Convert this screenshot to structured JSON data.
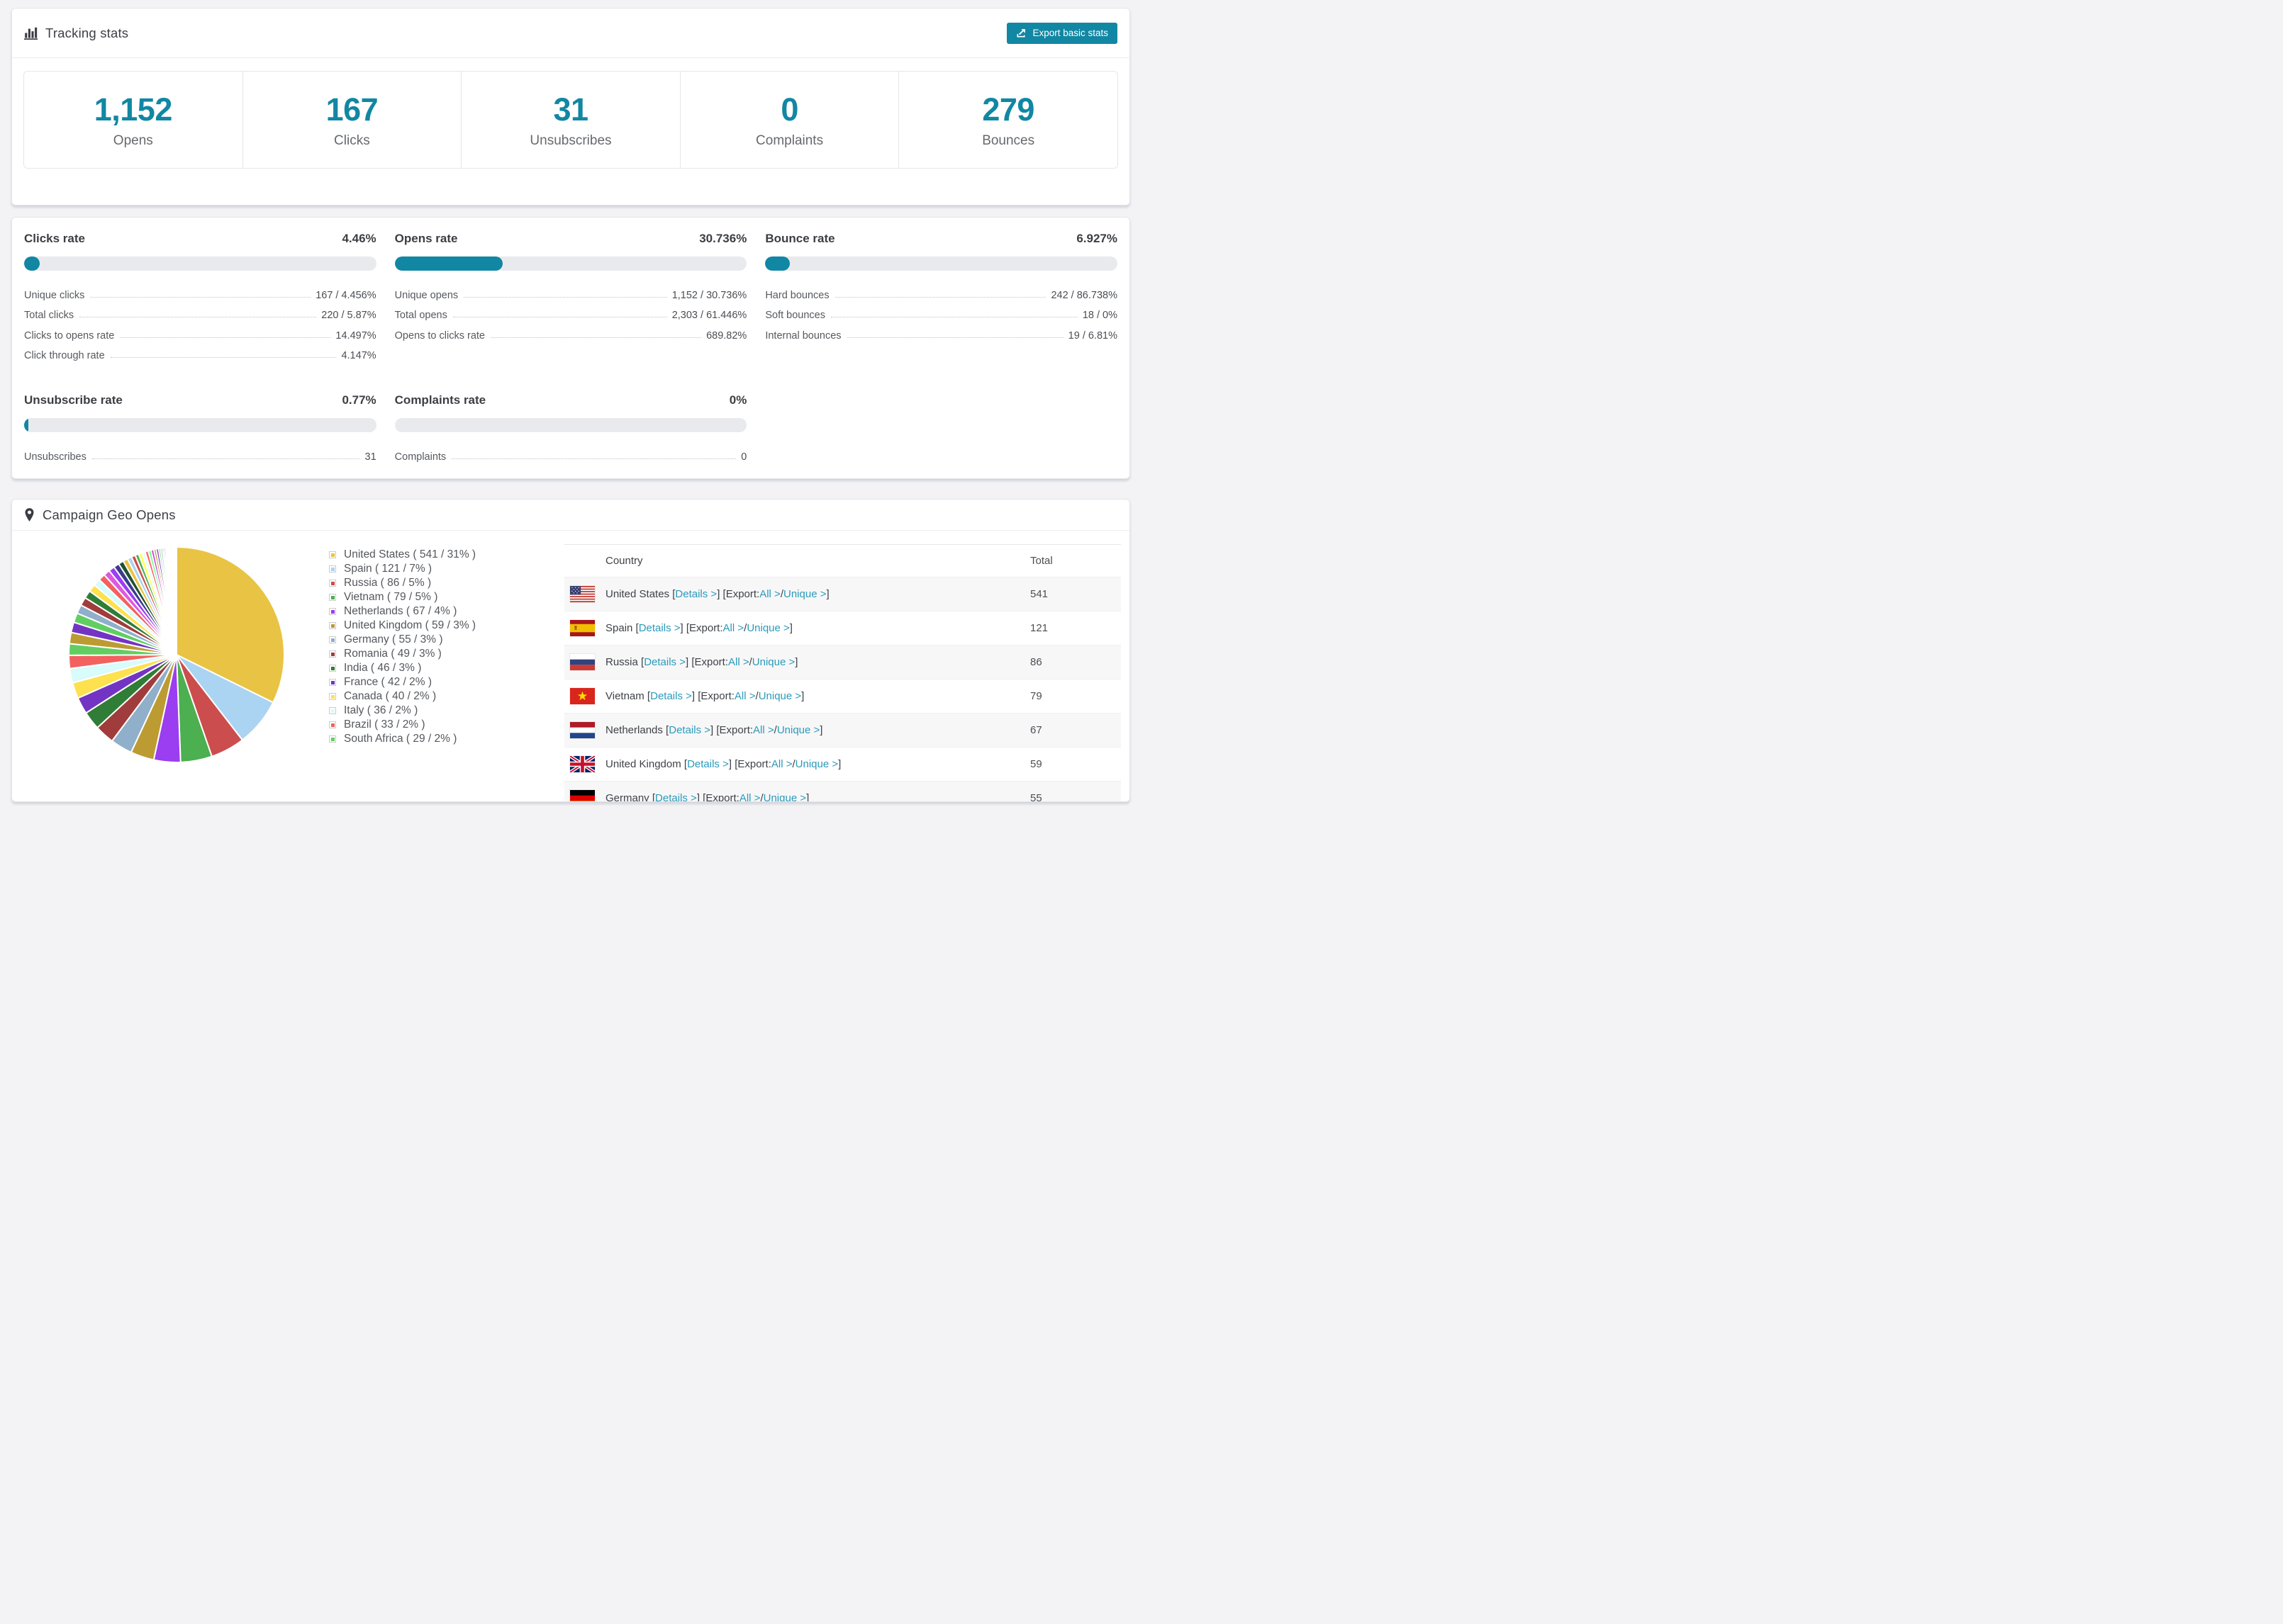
{
  "colors": {
    "accent": "#1187a3",
    "link": "#2b9aba",
    "bar_background": "#e9eaee",
    "alt_row_background": "#f7f7f8"
  },
  "tracking": {
    "title": "Tracking stats",
    "export_label": "Export basic stats",
    "stats": [
      {
        "value": "1,152",
        "label": "Opens"
      },
      {
        "value": "167",
        "label": "Clicks"
      },
      {
        "value": "31",
        "label": "Unsubscribes"
      },
      {
        "value": "0",
        "label": "Complaints"
      },
      {
        "value": "279",
        "label": "Bounces"
      }
    ]
  },
  "rates": [
    {
      "title": "Clicks rate",
      "value": "4.46%",
      "pct": 4.46,
      "rows": [
        {
          "label": "Unique clicks",
          "value": "167 / 4.456%"
        },
        {
          "label": "Total clicks",
          "value": "220 / 5.87%"
        },
        {
          "label": "Clicks to opens rate",
          "value": "14.497%"
        },
        {
          "label": "Click through rate",
          "value": "4.147%"
        }
      ]
    },
    {
      "title": "Opens rate",
      "value": "30.736%",
      "pct": 30.736,
      "rows": [
        {
          "label": "Unique opens",
          "value": "1,152 / 30.736%"
        },
        {
          "label": "Total opens",
          "value": "2,303 / 61.446%"
        },
        {
          "label": "Opens to clicks rate",
          "value": "689.82%"
        }
      ]
    },
    {
      "title": "Bounce rate",
      "value": "6.927%",
      "pct": 6.927,
      "rows": [
        {
          "label": "Hard bounces",
          "value": "242 / 86.738%"
        },
        {
          "label": "Soft bounces",
          "value": "18 / 0%"
        },
        {
          "label": "Internal bounces",
          "value": "19 / 6.81%"
        }
      ]
    },
    {
      "title": "Unsubscribe rate",
      "value": "0.77%",
      "pct": 0.77,
      "rows": [
        {
          "label": "Unsubscribes",
          "value": "31"
        }
      ]
    },
    {
      "title": "Complaints rate",
      "value": "0%",
      "pct": 0,
      "rows": [
        {
          "label": "Complaints",
          "value": "0"
        }
      ]
    }
  ],
  "geo": {
    "title": "Campaign Geo Opens",
    "table": {
      "headers": [
        "Country",
        "Total"
      ],
      "link_labels": {
        "details": "Details",
        "export": "Export:",
        "all": "All",
        "unique": "Unique"
      },
      "rows": [
        {
          "country": "United States",
          "flag": "us",
          "total": "541"
        },
        {
          "country": "Spain",
          "flag": "es",
          "total": "121"
        },
        {
          "country": "Russia",
          "flag": "ru",
          "total": "86"
        },
        {
          "country": "Vietnam",
          "flag": "vn",
          "total": "79"
        },
        {
          "country": "Netherlands",
          "flag": "nl",
          "total": "67"
        },
        {
          "country": "United Kingdom",
          "flag": "gb",
          "total": "59"
        },
        {
          "country": "Germany",
          "flag": "de",
          "total": "55"
        }
      ]
    }
  },
  "chart_data": {
    "type": "pie",
    "title": "Campaign Geo Opens",
    "legend_position": "right",
    "legend_format": "{label} ( {value} / {pct}% )",
    "slices": [
      {
        "label": "United States",
        "value": 541,
        "pct": 31,
        "color": "#e9c343"
      },
      {
        "label": "Spain",
        "value": 121,
        "pct": 7,
        "color": "#abd3f2"
      },
      {
        "label": "Russia",
        "value": 86,
        "pct": 5,
        "color": "#cc4d4d"
      },
      {
        "label": "Vietnam",
        "value": 79,
        "pct": 5,
        "color": "#4caf50"
      },
      {
        "label": "Netherlands",
        "value": 67,
        "pct": 4,
        "color": "#9b3df0"
      },
      {
        "label": "United Kingdom",
        "value": 59,
        "pct": 3,
        "color": "#bd9b33"
      },
      {
        "label": "Germany",
        "value": 55,
        "pct": 3,
        "color": "#8fafca"
      },
      {
        "label": "Romania",
        "value": 49,
        "pct": 3,
        "color": "#a03c3c"
      },
      {
        "label": "India",
        "value": 46,
        "pct": 3,
        "color": "#2f7d36"
      },
      {
        "label": "France",
        "value": 42,
        "pct": 2,
        "color": "#7334c4"
      },
      {
        "label": "Canada",
        "value": 40,
        "pct": 2,
        "color": "#fde14e"
      },
      {
        "label": "Italy",
        "value": 36,
        "pct": 2,
        "color": "#d8fbfb"
      },
      {
        "label": "Brazil",
        "value": 33,
        "pct": 2,
        "color": "#f2615f"
      },
      {
        "label": "South Africa",
        "value": 29,
        "pct": 2,
        "color": "#62ce62"
      }
    ],
    "others_estimated_values": [
      28,
      26,
      24,
      22,
      21,
      20,
      19,
      18,
      17,
      16,
      15,
      14,
      13,
      12,
      11,
      10,
      9,
      9,
      8,
      8,
      7,
      7,
      6,
      6,
      5,
      5,
      4,
      4,
      3,
      3,
      3,
      2,
      2,
      2,
      2,
      2,
      1,
      1,
      1,
      1,
      1,
      1,
      1,
      1
    ],
    "others_palette": [
      "#bd9b33",
      "#7334c4",
      "#62ce62",
      "#8fafca",
      "#a03c3c",
      "#2f7d36",
      "#fde14e",
      "#d8fbfb",
      "#f2615f",
      "#df57e0",
      "#9b3df0",
      "#3b3b8e",
      "#1f5131",
      "#e9c343",
      "#abd3f2",
      "#cc4d4d",
      "#4caf50",
      "#ffff55",
      "#e0ffff",
      "#ff6666",
      "#66ff88",
      "#cc44cc"
    ]
  }
}
